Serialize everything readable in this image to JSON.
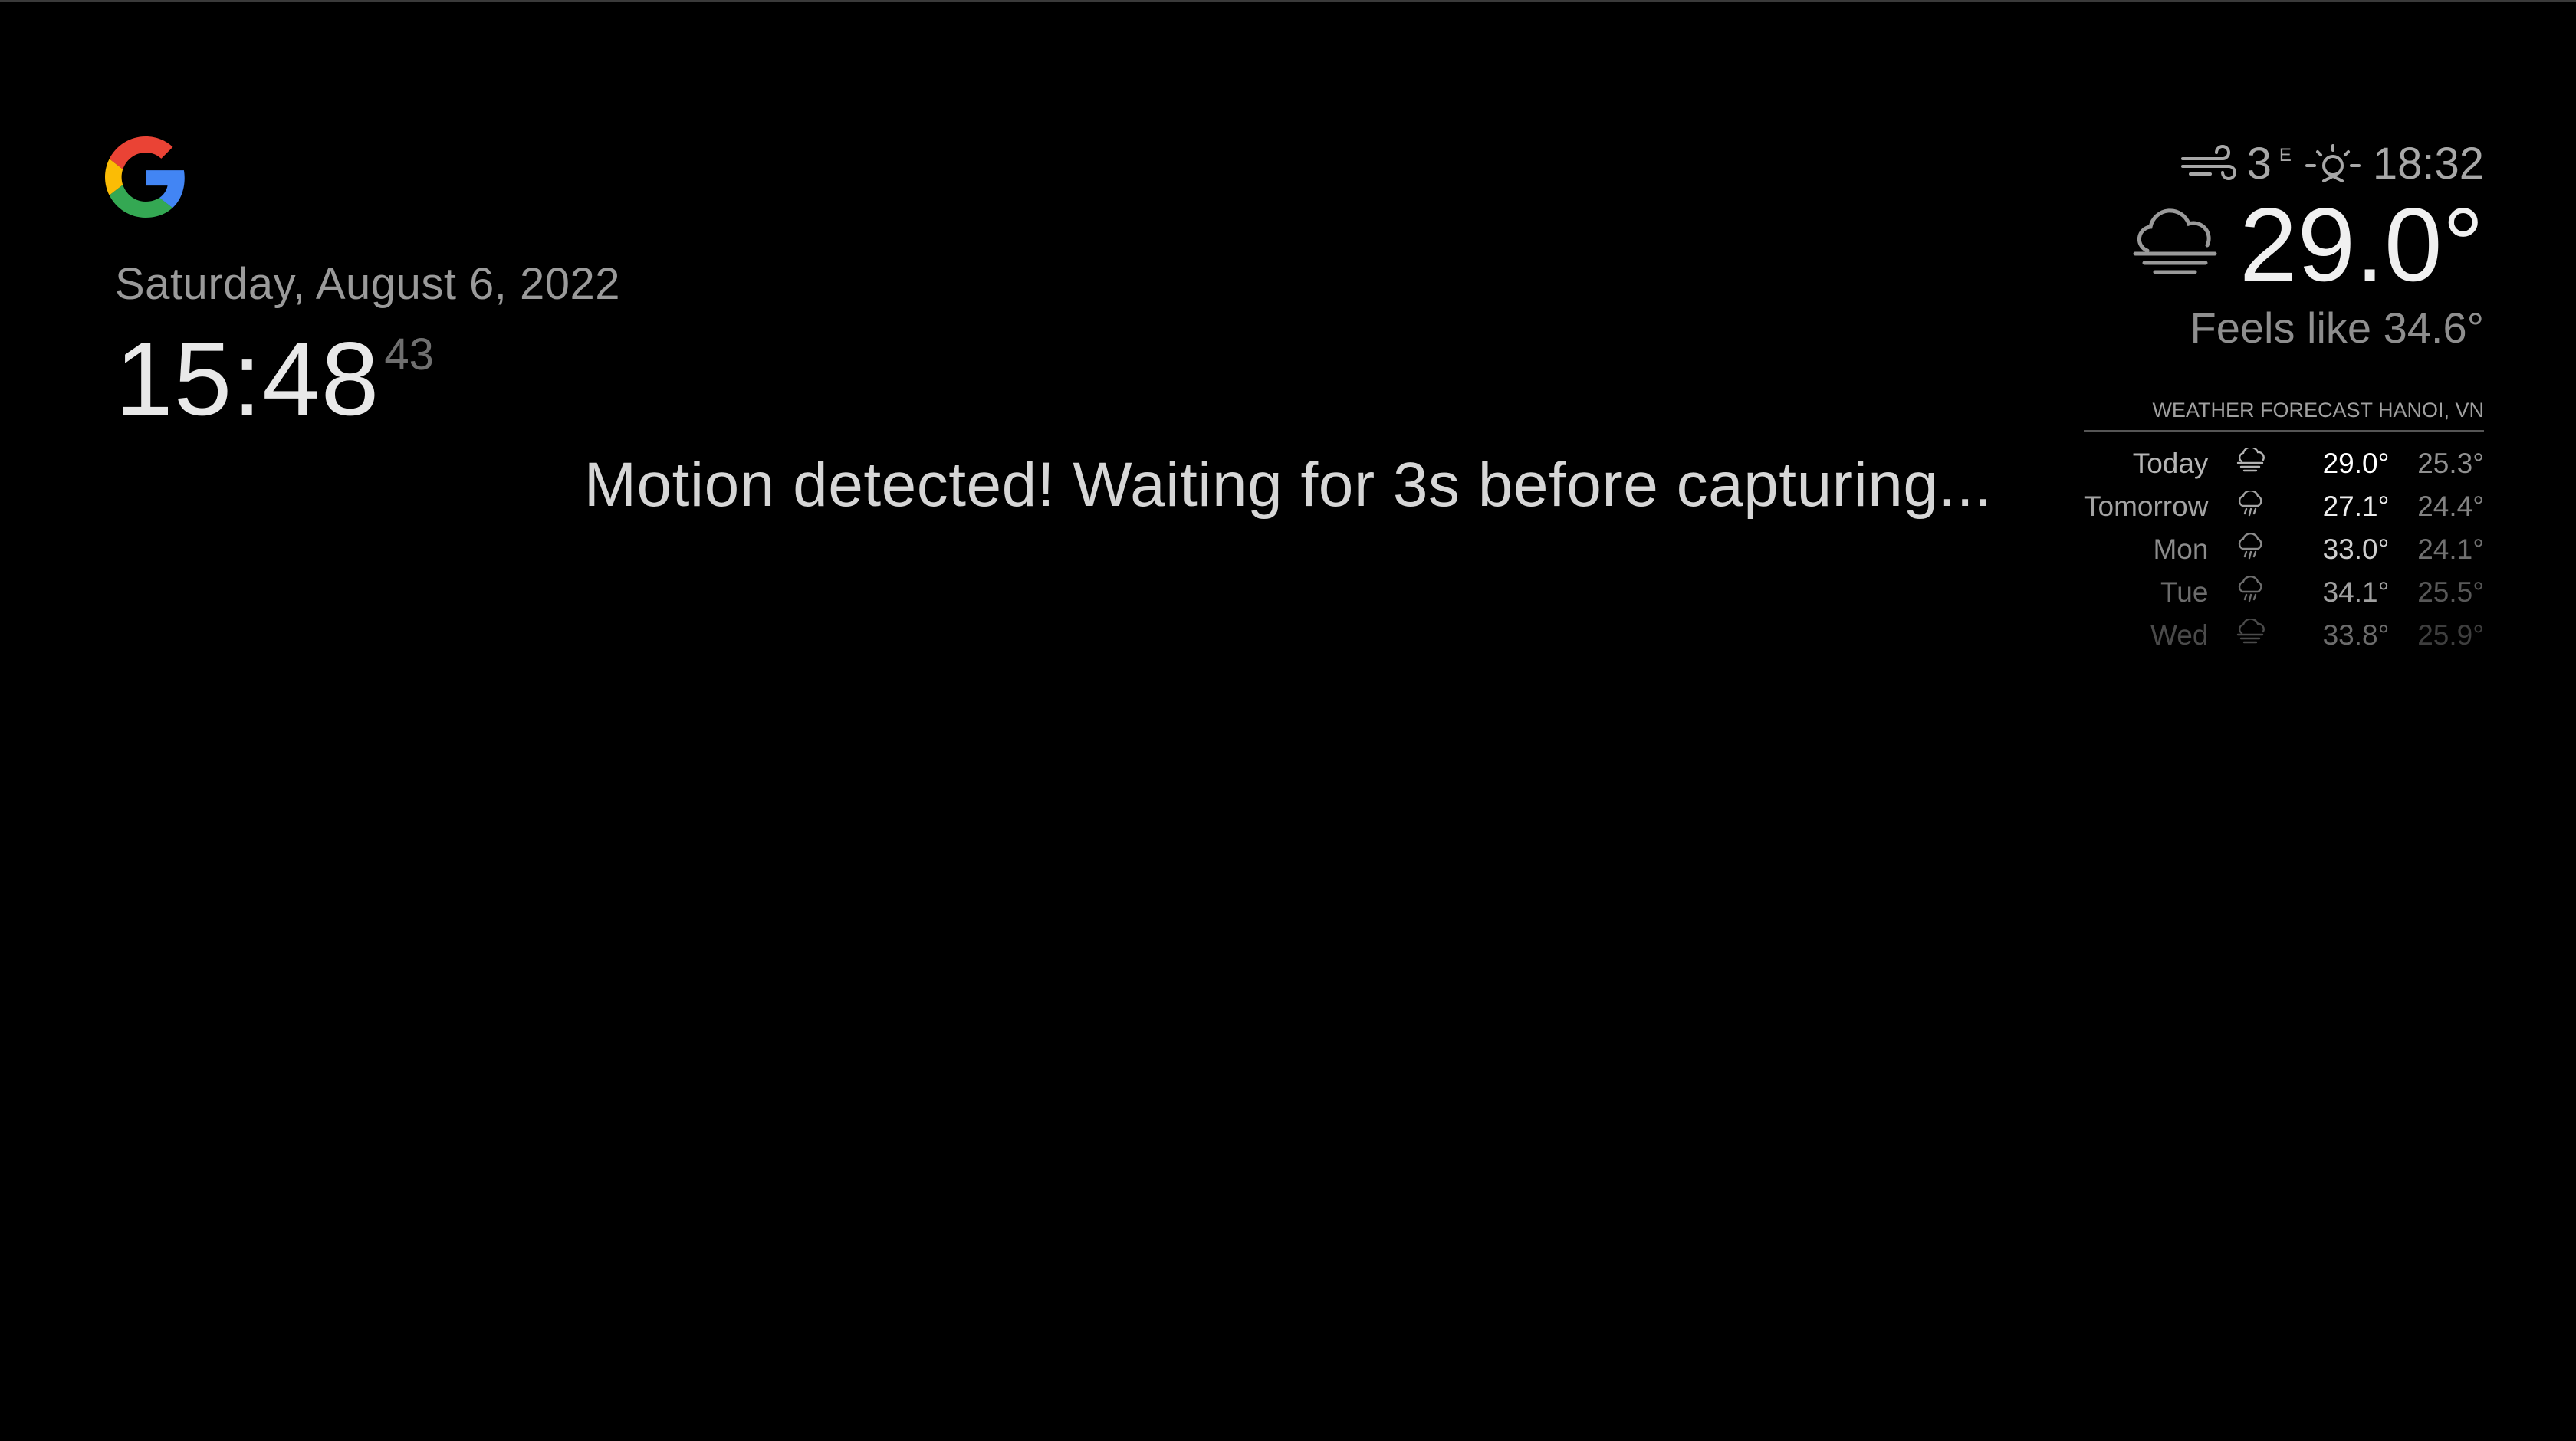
{
  "clock": {
    "date": "Saturday, August 6, 2022",
    "time_hm": "15:48",
    "time_seconds": "43"
  },
  "motion": {
    "message": "Motion detected! Waiting for 3s before capturing..."
  },
  "current_weather": {
    "wind_speed": "3",
    "wind_direction": "E",
    "sunset_time": "18:32",
    "temperature": "29.0°",
    "feels_like": "Feels like 34.6°",
    "wind_icon": "wind-icon",
    "sunset_icon": "sunset-icon",
    "condition_icon": "cloudy-fog-icon"
  },
  "forecast": {
    "header": "WEATHER FORECAST HANOI, VN",
    "days": [
      {
        "day": "Today",
        "icon": "cloudy-fog-icon",
        "max": "29.0°",
        "min": "25.3°"
      },
      {
        "day": "Tomorrow",
        "icon": "rain-icon",
        "max": "27.1°",
        "min": "24.4°"
      },
      {
        "day": "Mon",
        "icon": "rain-icon",
        "max": "33.0°",
        "min": "24.1°"
      },
      {
        "day": "Tue",
        "icon": "rain-icon",
        "max": "34.1°",
        "min": "25.5°"
      },
      {
        "day": "Wed",
        "icon": "cloudy-fog-icon",
        "max": "33.8°",
        "min": "25.9°"
      }
    ]
  },
  "colors": {
    "background": "#000000",
    "google_blue": "#4285F4",
    "google_red": "#EA4335",
    "google_yellow": "#FBBC05",
    "google_green": "#34A853"
  }
}
